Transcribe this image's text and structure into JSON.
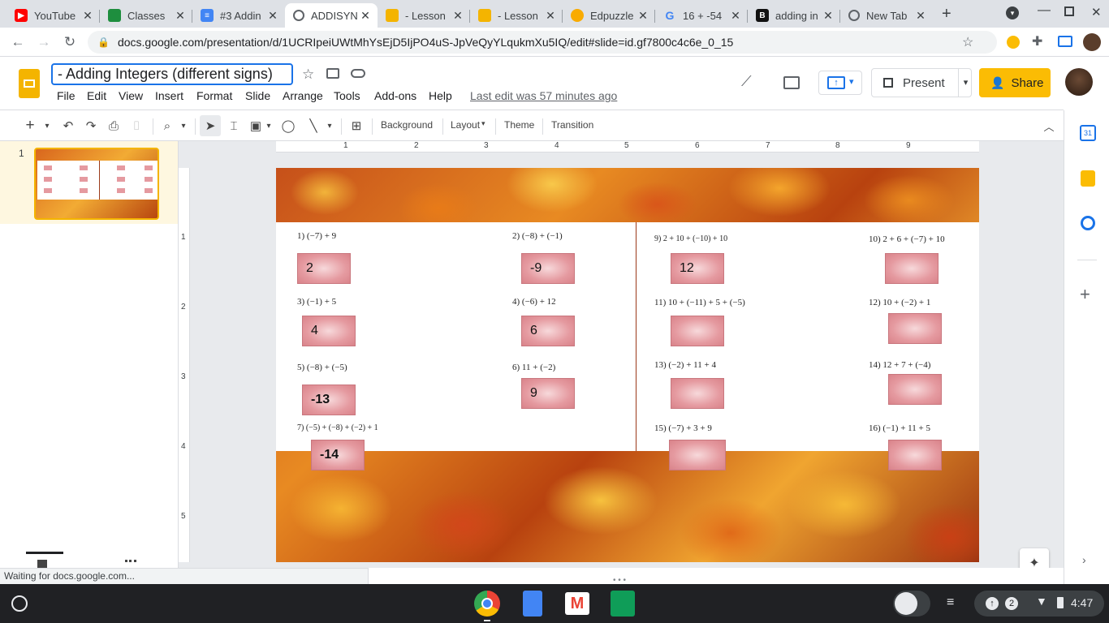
{
  "browser": {
    "tabs": [
      {
        "title": "YouTube",
        "icon": "youtube-icon",
        "color": "#ff0000"
      },
      {
        "title": "Classes",
        "icon": "classroom-icon",
        "color": "#1e8e3e"
      },
      {
        "title": "#3 Addin",
        "icon": "forms-icon",
        "color": "#4285f4"
      },
      {
        "title": "ADDISYN",
        "icon": "loading-globe-icon",
        "color": "#5f6368"
      },
      {
        "title": "- Lesson",
        "icon": "slides-icon",
        "color": "#f4b400"
      },
      {
        "title": "- Lesson",
        "icon": "slides-icon",
        "color": "#f4b400"
      },
      {
        "title": "Edpuzzle",
        "icon": "edpuzzle-icon",
        "color": "#f9ab00"
      },
      {
        "title": "16 + -54",
        "icon": "google-icon",
        "color": "#4285f4"
      },
      {
        "title": "adding in",
        "icon": "b-icon",
        "color": "#111111"
      },
      {
        "title": "New Tab",
        "icon": "chrome-icon",
        "color": "#5f6368"
      }
    ],
    "url": "docs.google.com/presentation/d/1UCRIpeiUWtMhYsEjD5IjPO4uS-JpVeQyYLqukmXu5IQ/edit#slide=id.gf7800c4c6e_0_15"
  },
  "docs": {
    "title": "- Adding Integers (different signs)",
    "menus": [
      "File",
      "Edit",
      "View",
      "Insert",
      "Format",
      "Slide",
      "Arrange",
      "Tools",
      "Add-ons",
      "Help"
    ],
    "last_edit": "Last edit was 57 minutes ago",
    "present_label": "Present",
    "share_label": "Share"
  },
  "toolbar": {
    "background": "Background",
    "layout": "Layout",
    "theme": "Theme",
    "transition": "Transition"
  },
  "filmstrip": {
    "slide_number": "1"
  },
  "ruler": {
    "h": [
      "1",
      "2",
      "3",
      "4",
      "5",
      "6",
      "7",
      "8",
      "9"
    ],
    "v": [
      "1",
      "2",
      "3",
      "4",
      "5"
    ]
  },
  "slide": {
    "problems": [
      {
        "label": "1)",
        "expr": "(−7) + 9",
        "answer": "2"
      },
      {
        "label": "2)",
        "expr": "(−8) + (−1)",
        "answer": "-9"
      },
      {
        "label": "3)",
        "expr": "(−1) + 5",
        "answer": "4"
      },
      {
        "label": "4)",
        "expr": "(−6) + 12",
        "answer": "6"
      },
      {
        "label": "5)",
        "expr": "(−8) + (−5)",
        "answer": "-13"
      },
      {
        "label": "6)",
        "expr": "11 + (−2)",
        "answer": "9"
      },
      {
        "label": "7)",
        "expr": "(−5) + (−8) + (−2) + 1",
        "answer": "-14"
      },
      {
        "label": "9)",
        "expr": "2 + 10 + (−10) + 10",
        "answer": "12"
      },
      {
        "label": "10)",
        "expr": "2 + 6 + (−7) + 10",
        "answer": ""
      },
      {
        "label": "11)",
        "expr": "10 + (−11) + 5 + (−5)",
        "answer": ""
      },
      {
        "label": "12)",
        "expr": "10 + (−2) + 1",
        "answer": ""
      },
      {
        "label": "13)",
        "expr": "(−2) + 11 + 4",
        "answer": ""
      },
      {
        "label": "14)",
        "expr": "12 + 7 + (−4)",
        "answer": ""
      },
      {
        "label": "15)",
        "expr": "(−7) + 3 + 9",
        "answer": ""
      },
      {
        "label": "16)",
        "expr": "(−1) + 11 + 5",
        "answer": ""
      }
    ]
  },
  "status": {
    "text": "Waiting for docs.google.com..."
  },
  "shelf": {
    "notifications": "2",
    "time": "4:47"
  },
  "colors": {
    "share_yellow": "#fbbc04",
    "accent_blue": "#1a73e8",
    "answer_pink": "#e59aa0"
  }
}
